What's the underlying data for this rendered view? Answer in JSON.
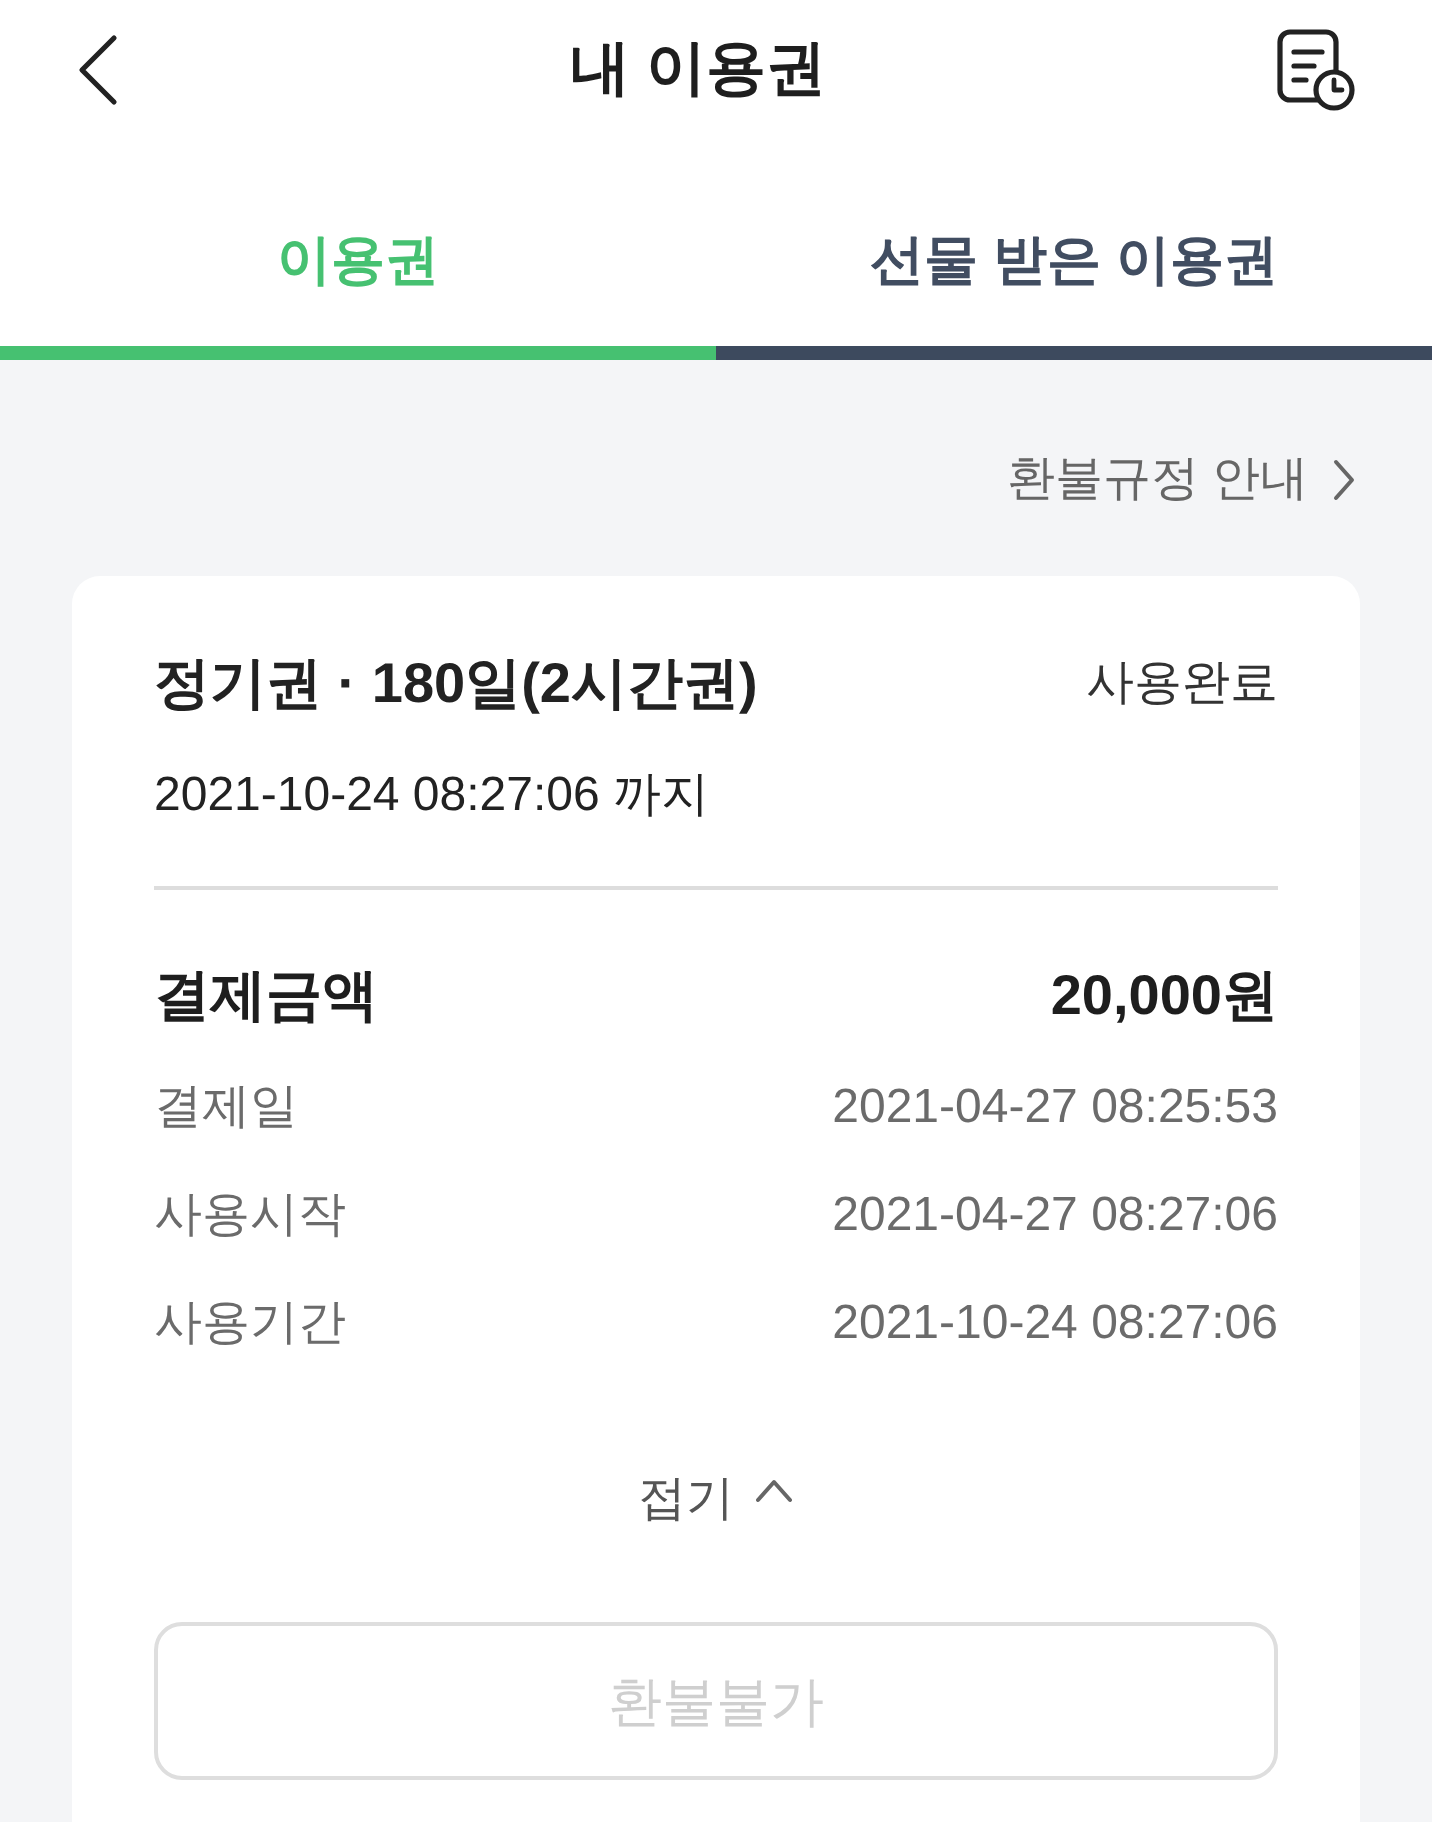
{
  "header": {
    "title": "내 이용권"
  },
  "tabs": [
    {
      "label": "이용권",
      "selected": true
    },
    {
      "label": "선물 받은 이용권",
      "selected": false
    }
  ],
  "refund_policy_link": {
    "label": "환불규정 안내"
  },
  "pass_card": {
    "title": "정기권 · 180일(2시간권)",
    "status": "사용완료",
    "valid_until": "2021-10-24 08:27:06 까지",
    "amount": {
      "label": "결제금액",
      "value": "20,000원"
    },
    "details": [
      {
        "label": "결제일",
        "value": "2021-04-27 08:25:53"
      },
      {
        "label": "사용시작",
        "value": "2021-04-27 08:27:06"
      },
      {
        "label": "사용기간",
        "value": "2021-10-24 08:27:06"
      }
    ],
    "collapse_toggle": {
      "label": "접기",
      "expanded": true
    },
    "refund_button": {
      "label": "환불불가",
      "disabled": true
    }
  }
}
